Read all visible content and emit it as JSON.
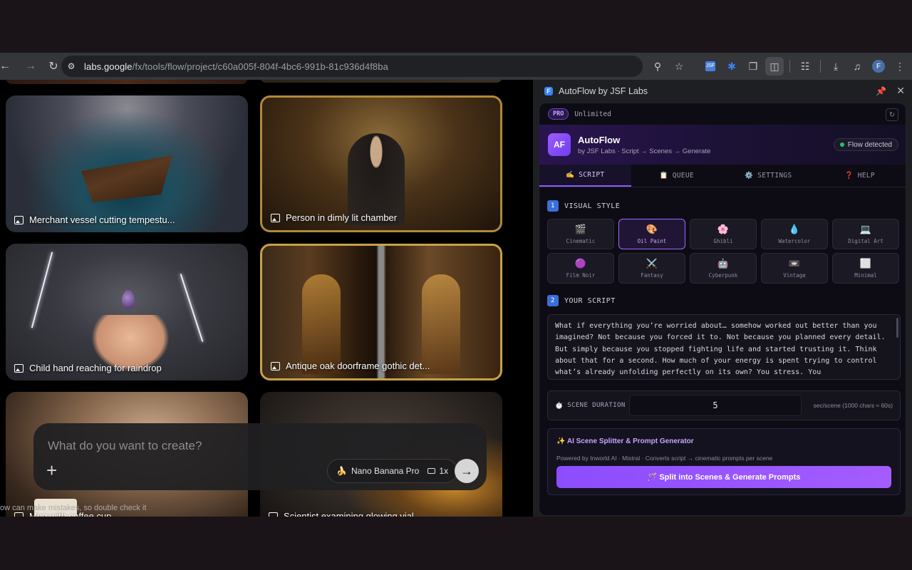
{
  "browser": {
    "url_host": "labs.google",
    "url_path": "/fx/tools/flow/project/c60a005f-804f-4bc6-991b-81c936d4f8ba",
    "profile_initial": "F"
  },
  "gallery": {
    "tiles": [
      {
        "caption": "Merchant vessel cutting tempestu..."
      },
      {
        "caption": "Person in dimly lit chamber"
      },
      {
        "caption": "Child hand reaching for raindrop"
      },
      {
        "caption": "Antique oak doorframe gothic det..."
      },
      {
        "caption": "Mug with coffee cup"
      },
      {
        "caption": "Scientist examining glowing vial"
      }
    ]
  },
  "prompt": {
    "placeholder": "What do you want to create?",
    "model": "Nano Banana Pro",
    "count": "1x",
    "disclaimer": "ow can make mistakes, so double check it"
  },
  "panel": {
    "title": "AutoFlow by JSF Labs",
    "plan_badge": "PRO",
    "plan_label": "Unlimited",
    "brand_logo": "AF",
    "brand_name": "AutoFlow",
    "brand_sub": "by JSF Labs · Script → Scenes → Generate",
    "status": "Flow detected",
    "tabs": [
      {
        "label": "✍️ SCRIPT"
      },
      {
        "label": "📋 QUEUE"
      },
      {
        "label": "⚙️ SETTINGS"
      },
      {
        "label": "❓ HELP"
      }
    ],
    "visual_style": {
      "number": "1",
      "title": "VISUAL STYLE",
      "options": [
        {
          "icon": "🎬",
          "label": "Cinematic"
        },
        {
          "icon": "🎨",
          "label": "Oil Paint"
        },
        {
          "icon": "🌸",
          "label": "Ghibli"
        },
        {
          "icon": "💧",
          "label": "Watercolor"
        },
        {
          "icon": "💻",
          "label": "Digital Art"
        },
        {
          "icon": "🟣",
          "label": "Film Noir"
        },
        {
          "icon": "⚔️",
          "label": "Fantasy"
        },
        {
          "icon": "🤖",
          "label": "Cyberpunk"
        },
        {
          "icon": "📼",
          "label": "Vintage"
        },
        {
          "icon": "⬜",
          "label": "Minimal"
        }
      ],
      "selected": "Oil Paint"
    },
    "script": {
      "number": "2",
      "title": "YOUR SCRIPT",
      "text": "What if everything you’re worried about… somehow worked out better than you imagined? Not because you forced it to. Not because you planned every detail. But simply because you stopped fighting life and started trusting it. Think about that for a second. How much of your energy is spent trying to control what’s already unfolding perfectly on its own? You stress. You"
    },
    "duration": {
      "icon": "⏱️",
      "label": "SCENE DURATION",
      "value": "5",
      "hint": "sec/scene (1000 chars ≈ 60s)"
    },
    "ai": {
      "title": "✨ AI Scene Splitter & Prompt Generator",
      "subtitle": "Powered by Inworld AI · Mistral · Converts script → cinematic prompts per scene",
      "button": "🪄 Split into Scenes & Generate Prompts"
    }
  }
}
